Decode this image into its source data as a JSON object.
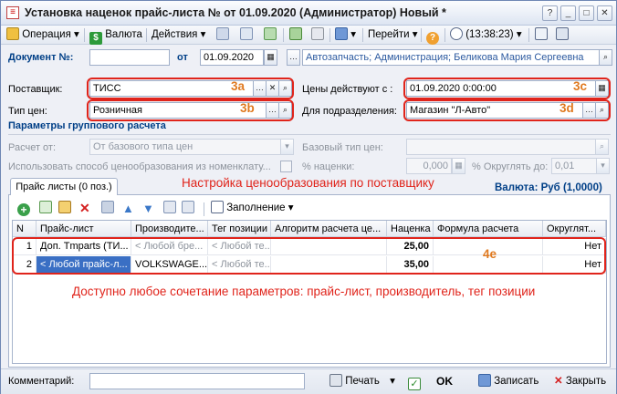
{
  "window": {
    "title": "Установка наценок прайс-листа №  от 01.09.2020 (Администратор) Новый *"
  },
  "toolbar": {
    "operation": "Операция",
    "currency": "Валюта",
    "actions": "Действия",
    "goto": "Перейти",
    "time": "(13:38:23)"
  },
  "header": {
    "doc_label": "Документ №:",
    "doc_value": "",
    "from_label": "от",
    "date": "01.09.2020",
    "org": "Автозапчасть; Администрация; Беликова Мария Сергеевна"
  },
  "form": {
    "supplier_label": "Поставщик:",
    "supplier_value": "ТИСС",
    "price_type_label": "Тип цен:",
    "price_type_value": "Розничная",
    "valid_label": "Цены действуют с :",
    "valid_value": "01.09.2020  0:00:00",
    "division_label": "Для подразделения:",
    "division_value": "Магазин \"Л-Авто\""
  },
  "tags": {
    "a": "3а",
    "b": "3b",
    "c": "3c",
    "d": "3d",
    "e": "4е"
  },
  "group_calc": {
    "title": "Параметры группового расчета",
    "calc_from_label": "Расчет от:",
    "calc_from_value": "От базового типа цен",
    "base_label": "Базовый тип цен:",
    "base_value": "",
    "use_method_label": "Использовать способ ценообразования из номенклату...",
    "markup_label": "% наценки:",
    "markup_value": "0,000",
    "round_label": "% Округлять до:",
    "round_value": "0,01"
  },
  "annotations": {
    "top": "Настройка ценообразования по поставщику",
    "bottom": "Доступно любое сочетание параметров: прайс-лист, производитель, тег позиции"
  },
  "tabs": {
    "price_lists": "Прайс листы (0 поз.)"
  },
  "currency_info": "Валюта: Руб (1,0000)",
  "grid_toolbar": {
    "fill": "Заполнение"
  },
  "grid": {
    "columns": [
      "N",
      "Прайс-лист",
      "Производите...",
      "Тег позиции",
      "Алгоритм расчета це...",
      "Наценка",
      "Формула расчета",
      "Округлят..."
    ],
    "rows": [
      {
        "n": "1",
        "price_list": "Доп. Tmparts (ТИ...",
        "maker": "< Любой бре...",
        "tag": "< Любой те...",
        "algo": "",
        "markup": "25,00",
        "formula": "",
        "round": "Нет"
      },
      {
        "n": "2",
        "price_list": "< Любой прайс-л...",
        "maker": "VOLKSWAGE...",
        "tag": "< Любой те...",
        "algo": "",
        "markup": "35,00",
        "formula": "",
        "round": "Нет"
      }
    ]
  },
  "footer": {
    "comment_label": "Комментарий:",
    "comment_value": "",
    "print": "Печать",
    "ok": "OK",
    "save": "Записать",
    "close": "Закрыть"
  },
  "colors": {
    "annotation_red": "#e0241b",
    "tag_orange": "#e07a20",
    "accent_blue": "#003f87"
  }
}
